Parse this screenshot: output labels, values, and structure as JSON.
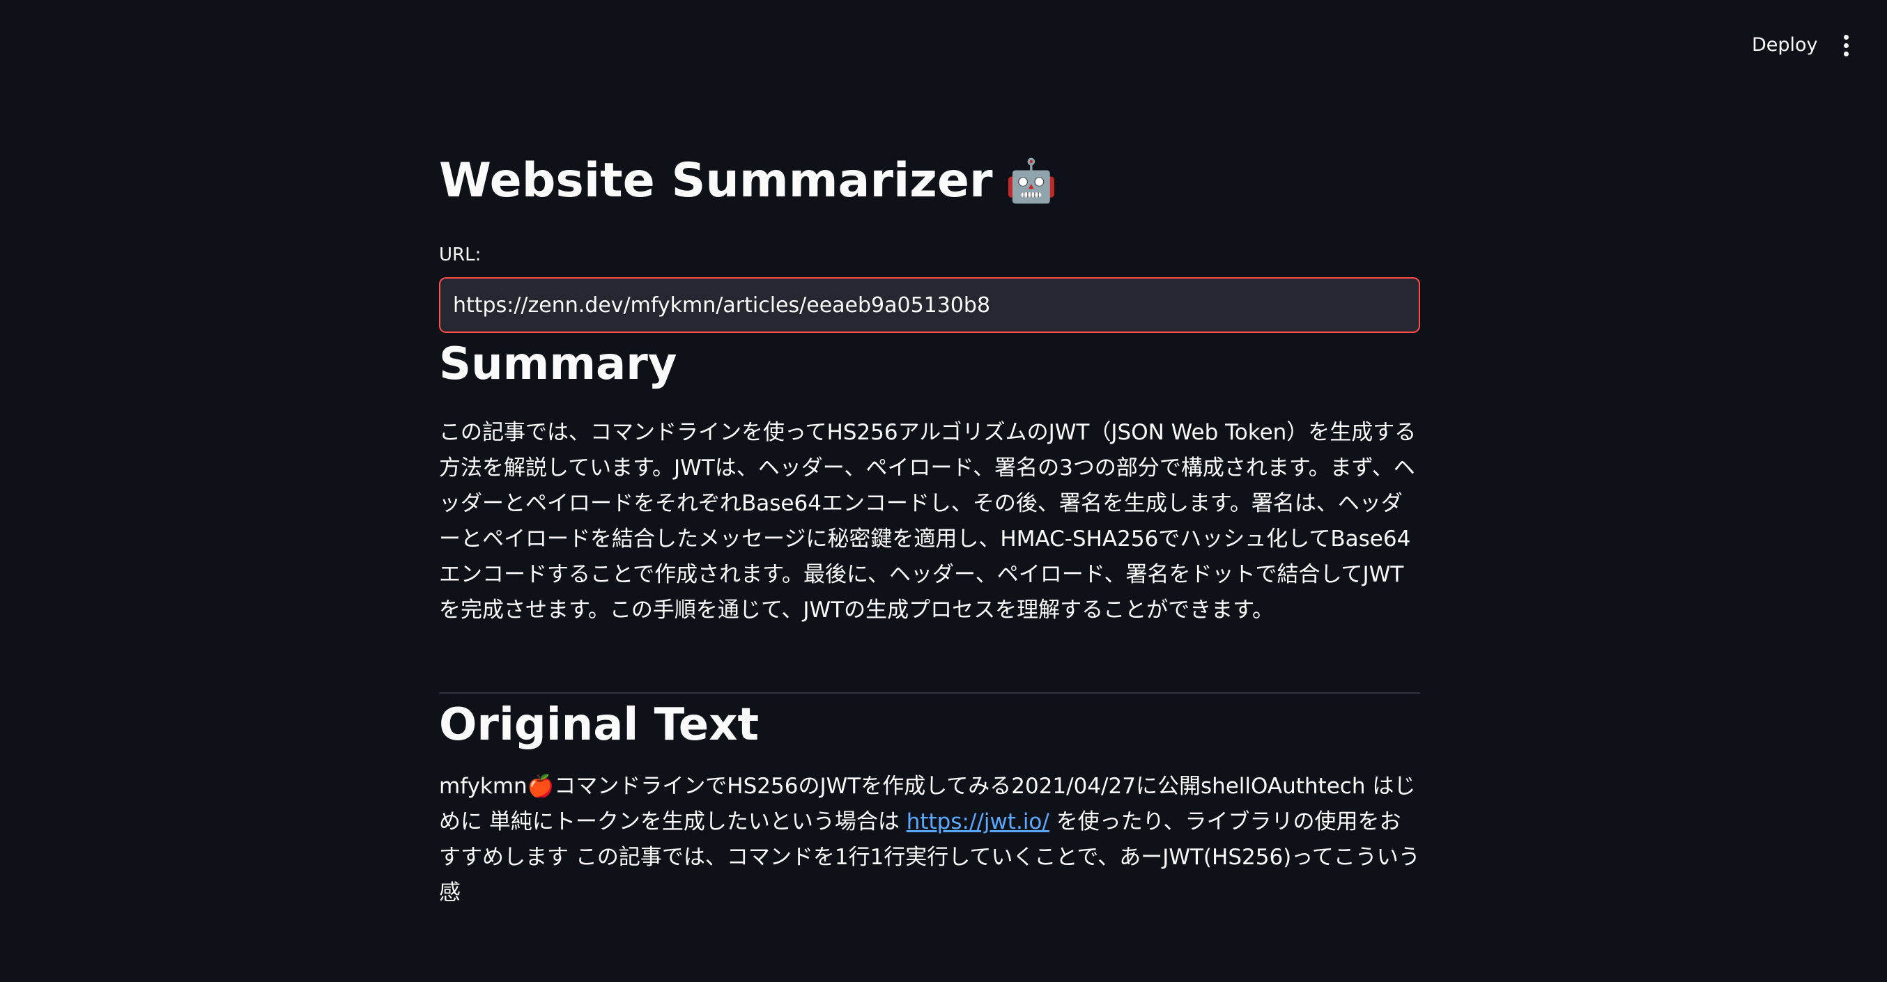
{
  "header": {
    "deploy_label": "Deploy"
  },
  "app": {
    "title": "Website Summarizer",
    "title_emoji": "🤖"
  },
  "url_field": {
    "label": "URL:",
    "value": "https://zenn.dev/mfykmn/articles/eeaeb9a05130b8"
  },
  "summary": {
    "heading": "Summary",
    "text": "この記事では、コマンドラインを使ってHS256アルゴリズムのJWT（JSON Web Token）を生成する方法を解説しています。JWTは、ヘッダー、ペイロード、署名の3つの部分で構成されます。まず、ヘッダーとペイロードをそれぞれBase64エンコードし、その後、署名を生成します。署名は、ヘッダーとペイロードを結合したメッセージに秘密鍵を適用し、HMAC-SHA256でハッシュ化してBase64エンコードすることで作成されます。最後に、ヘッダー、ペイロード、署名をドットで結合してJWTを完成させます。この手順を通じて、JWTの生成プロセスを理解することができます。"
  },
  "original": {
    "heading": "Original Text",
    "text_before_link": "mfykmn🍎コマンドラインでHS256のJWTを作成してみる2021/04/27に公開shellOAuthtech はじめに 単純にトークンを生成したいという場合は ",
    "link_text": "https://jwt.io/",
    "text_after_link": " を使ったり、ライブラリの使用をおすすめします この記事では、コマンドを1行1行実行していくことで、あーJWT(HS256)ってこういう感"
  },
  "colors": {
    "background": "#0e1117",
    "input_background": "#262730",
    "input_border": "#ff4b4b",
    "link": "#5aa9ff",
    "divider": "#31333f"
  }
}
